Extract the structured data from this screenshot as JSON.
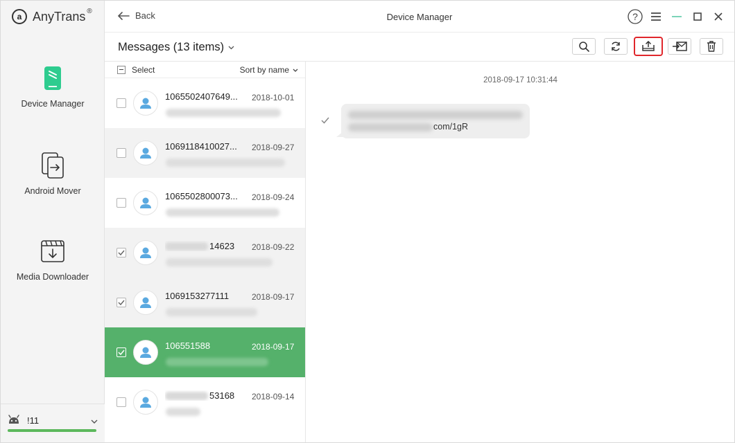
{
  "app": {
    "brand": "AnyTrans",
    "brand_mark": "a",
    "registered": "®"
  },
  "sidebar": {
    "items": [
      {
        "label": "Device Manager",
        "icon": "phone-icon",
        "color": "#2ecc8f"
      },
      {
        "label": "Android Mover",
        "icon": "transfer-icon"
      },
      {
        "label": "Media Downloader",
        "icon": "download-icon"
      }
    ],
    "device": {
      "name": "!11",
      "icon": "android-icon",
      "progress_color": "#5cb85c"
    }
  },
  "titlebar": {
    "back_label": "Back",
    "title": "Device Manager",
    "help": "?"
  },
  "toolbar": {
    "section_title": "Messages (13 items)",
    "buttons": [
      "search-icon",
      "refresh-icon",
      "export-to-pc-icon",
      "export-to-device-icon",
      "trash-icon"
    ],
    "highlight_color": "#e0262b"
  },
  "list": {
    "select_label": "Select",
    "sort_label": "Sort by name",
    "rows": [
      {
        "contact": "1065502407649...",
        "date": "2018-10-01",
        "checked": false,
        "preview_width": 166
      },
      {
        "contact": "1069118410027...",
        "date": "2018-09-27",
        "checked": false,
        "preview_width": 172
      },
      {
        "contact": "1065502800073...",
        "date": "2018-09-24",
        "checked": false,
        "preview_width": 164
      },
      {
        "contact": "14623",
        "date": "2018-09-22",
        "checked": true,
        "blurred_prefix": true,
        "preview_width": 154
      },
      {
        "contact": "1069153277111",
        "date": "2018-09-17",
        "checked": true,
        "preview_width": 132
      },
      {
        "contact": "106551588",
        "date": "2018-09-17",
        "checked": true,
        "selected": true,
        "preview_width": 148
      },
      {
        "contact": "53168",
        "date": "2018-09-14",
        "checked": false,
        "blurred_prefix": true,
        "preview_width": 50
      }
    ]
  },
  "detail": {
    "timestamp": "2018-09-17 10:31:44",
    "message_visible_text": "com/1gR"
  },
  "colors": {
    "selected_row": "#55b16b",
    "avatar": "#5aa9e0"
  }
}
